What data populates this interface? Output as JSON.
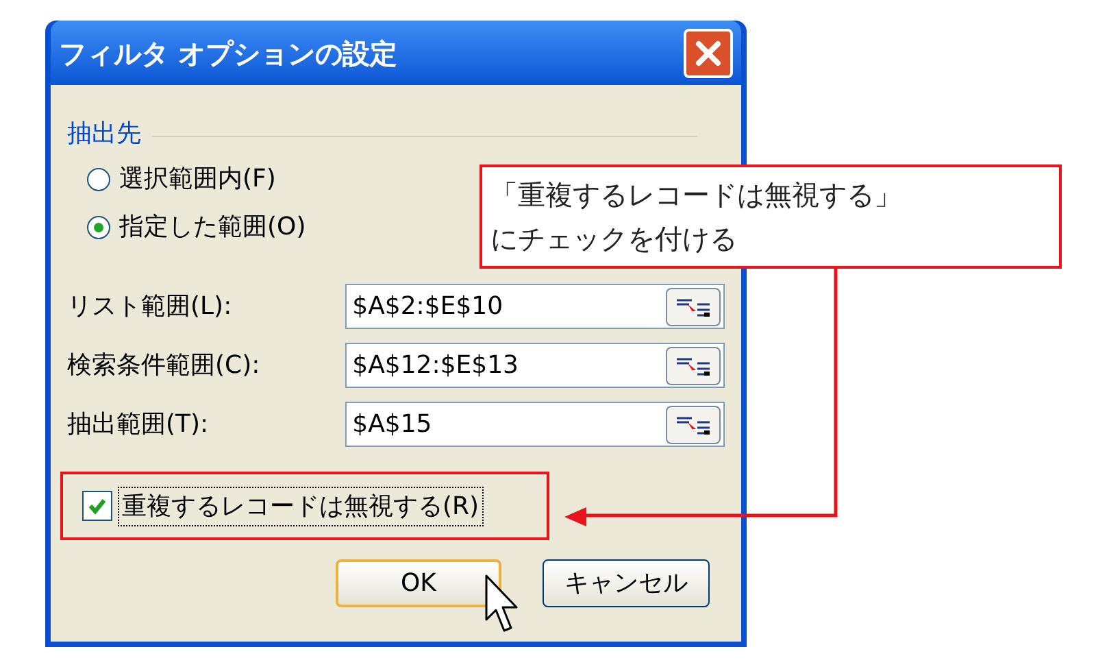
{
  "window": {
    "title": "フィルタ オプションの設定"
  },
  "destination": {
    "label": "抽出先",
    "options": [
      {
        "label": "選択範囲内(F)",
        "selected": false
      },
      {
        "label": "指定した範囲(O)",
        "selected": true
      }
    ]
  },
  "fields": [
    {
      "label": "リスト範囲(L):",
      "value": "$A$2:$E$10"
    },
    {
      "label": "検索条件範囲(C):",
      "value": "$A$12:$E$13"
    },
    {
      "label": "抽出範囲(T):",
      "value": "$A$15"
    }
  ],
  "unique_checkbox": {
    "label": "重複するレコードは無視する(R)",
    "checked": true
  },
  "buttons": [
    {
      "label": "OK",
      "default": true
    },
    {
      "label": "キャンセル",
      "default": false
    }
  ],
  "callout": {
    "lines": [
      "「重複するレコードは無視する」",
      "にチェックを付ける"
    ]
  }
}
